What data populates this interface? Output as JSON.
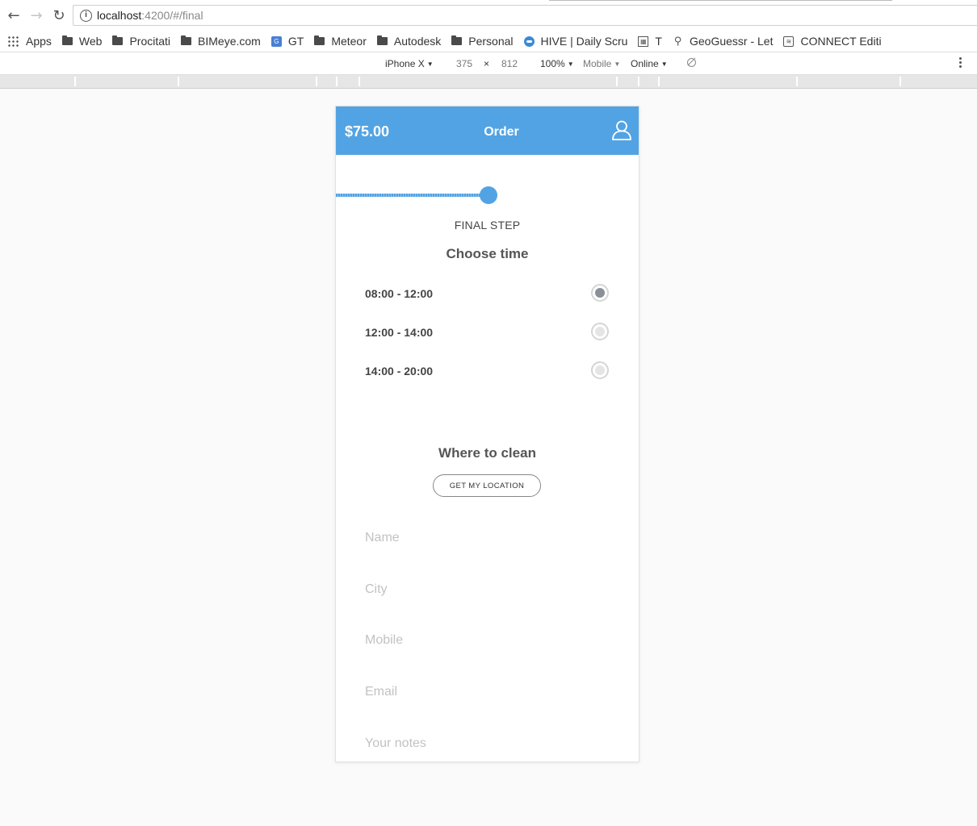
{
  "browser": {
    "back_icon": "arrow-left-icon",
    "forward_icon": "arrow-right-icon",
    "reload_icon": "reload-icon",
    "url_host": "localhost",
    "url_rest": ":4200/#/final"
  },
  "bookmarks": [
    {
      "label": "Apps",
      "icon": "apps-grid-icon"
    },
    {
      "label": "Web",
      "icon": "folder-icon"
    },
    {
      "label": "Procitati",
      "icon": "folder-icon"
    },
    {
      "label": "BIMeye.com",
      "icon": "folder-icon"
    },
    {
      "label": "GT",
      "icon": "translate-icon"
    },
    {
      "label": "Meteor",
      "icon": "folder-icon"
    },
    {
      "label": "Autodesk",
      "icon": "folder-icon"
    },
    {
      "label": "Personal",
      "icon": "folder-icon"
    },
    {
      "label": "HIVE | Daily Scru",
      "icon": "hive-icon"
    },
    {
      "label": "T",
      "icon": "t-icon"
    },
    {
      "label": "GeoGuessr - Let",
      "icon": "pin-icon"
    },
    {
      "label": "CONNECT Editi",
      "icon": "connect-icon"
    }
  ],
  "devtools": {
    "device": "iPhone X",
    "width": "375",
    "times": "×",
    "height": "812",
    "zoom": "100%",
    "mode": "Mobile",
    "network": "Online"
  },
  "app": {
    "price": "$75.00",
    "title": "Order",
    "progress_fraction": 0.5,
    "step_label": "FINAL STEP",
    "choose_time_title": "Choose time",
    "time_slots": [
      {
        "label": "08:00 - 12:00",
        "selected": true
      },
      {
        "label": "12:00 - 14:00",
        "selected": false
      },
      {
        "label": "14:00 - 20:00",
        "selected": false
      }
    ],
    "where_title": "Where to clean",
    "location_button": "GET MY LOCATION",
    "fields": {
      "name": "Name",
      "city": "City",
      "mobile": "Mobile",
      "email": "Email",
      "notes": "Your notes"
    }
  },
  "colors": {
    "accent": "#52a3e3",
    "radio_selected": "#8a8f98"
  }
}
